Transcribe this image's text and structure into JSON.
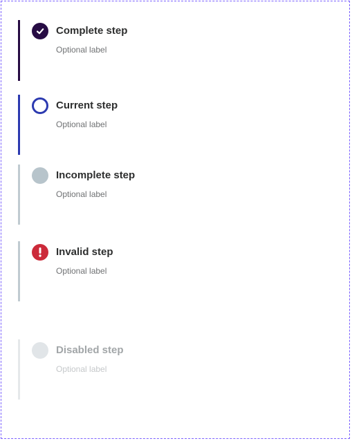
{
  "steps": [
    {
      "state": "complete",
      "title": "Complete step",
      "label": "Optional label",
      "icon": "check-circle-icon",
      "bar_color": "#270c44",
      "icon_color": "#270c44"
    },
    {
      "state": "current",
      "title": "Current step",
      "label": "Optional label",
      "icon": "empty-circle-icon",
      "bar_color": "#2c3ab0",
      "icon_color": "#2c3ab0"
    },
    {
      "state": "incomplete",
      "title": "Incomplete step",
      "label": "Optional label",
      "icon": "filled-circle-icon",
      "bar_color": "#c0cbd1",
      "icon_color": "#b7c4cb"
    },
    {
      "state": "invalid",
      "title": "Invalid step",
      "label": "Optional label",
      "icon": "error-icon",
      "bar_color": "#c0cbd1",
      "icon_color": "#cc2a3a"
    },
    {
      "state": "disabled",
      "title": "Disabled step",
      "label": "Optional label",
      "icon": "filled-circle-icon",
      "bar_color": "#e5e8ea",
      "icon_color": "#e1e5e8"
    }
  ]
}
